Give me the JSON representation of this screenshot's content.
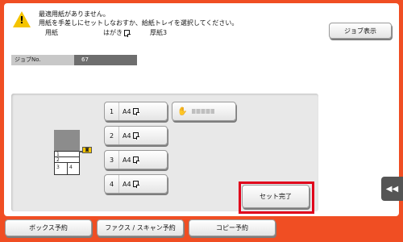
{
  "message": {
    "line1": "最適用紙がありません。",
    "line2": "用紙を手差しにセットしなおすか、給紙トレイを選択してください。",
    "paper_label": "用紙",
    "paper_size": "はがき",
    "paper_type": "厚紙3"
  },
  "header": {
    "job_display_label": "ジョブ表示"
  },
  "job": {
    "label": "ジョブNo.",
    "value": "67"
  },
  "trays": [
    {
      "number": "1",
      "size": "A4"
    },
    {
      "number": "2",
      "size": "A4"
    },
    {
      "number": "3",
      "size": "A4"
    },
    {
      "number": "4",
      "size": "A4"
    }
  ],
  "machine": {
    "cell1": "1",
    "cell2": "2",
    "cell3": "3",
    "cell4": "4"
  },
  "actions": {
    "set_done_label": "セット完了"
  },
  "side_tab": {
    "glyph": "◀◀"
  },
  "bottom_bar": {
    "box_reserve": "ボックス予約",
    "fax_scan_reserve": "ファクス / スキャン予約",
    "copy_reserve": "コピー予約"
  },
  "colors": {
    "frame": "#f04e23",
    "highlight": "#e0001b",
    "warning": "#f5c400"
  }
}
